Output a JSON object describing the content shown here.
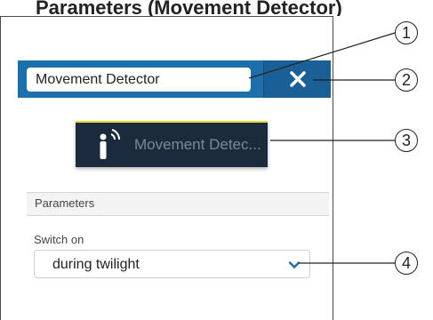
{
  "heading": "Parameters (Movement Detector)",
  "panel": {
    "name_value": "Movement Detector",
    "close_icon": "close-icon"
  },
  "widget": {
    "icon": "motion-sensor-icon",
    "label": "Movement Detec..."
  },
  "parameters": {
    "section_title": "Parameters",
    "switch_label": "Switch on",
    "switch_value": "during twilight",
    "chevron_icon": "chevron-down-icon"
  },
  "callouts": [
    "1",
    "2",
    "3",
    "4"
  ],
  "colors": {
    "header_blue": "#1c6fab",
    "close_blue": "#1a5f95",
    "widget_bg": "#1b2b3d",
    "widget_accent": "#e8e03a"
  }
}
